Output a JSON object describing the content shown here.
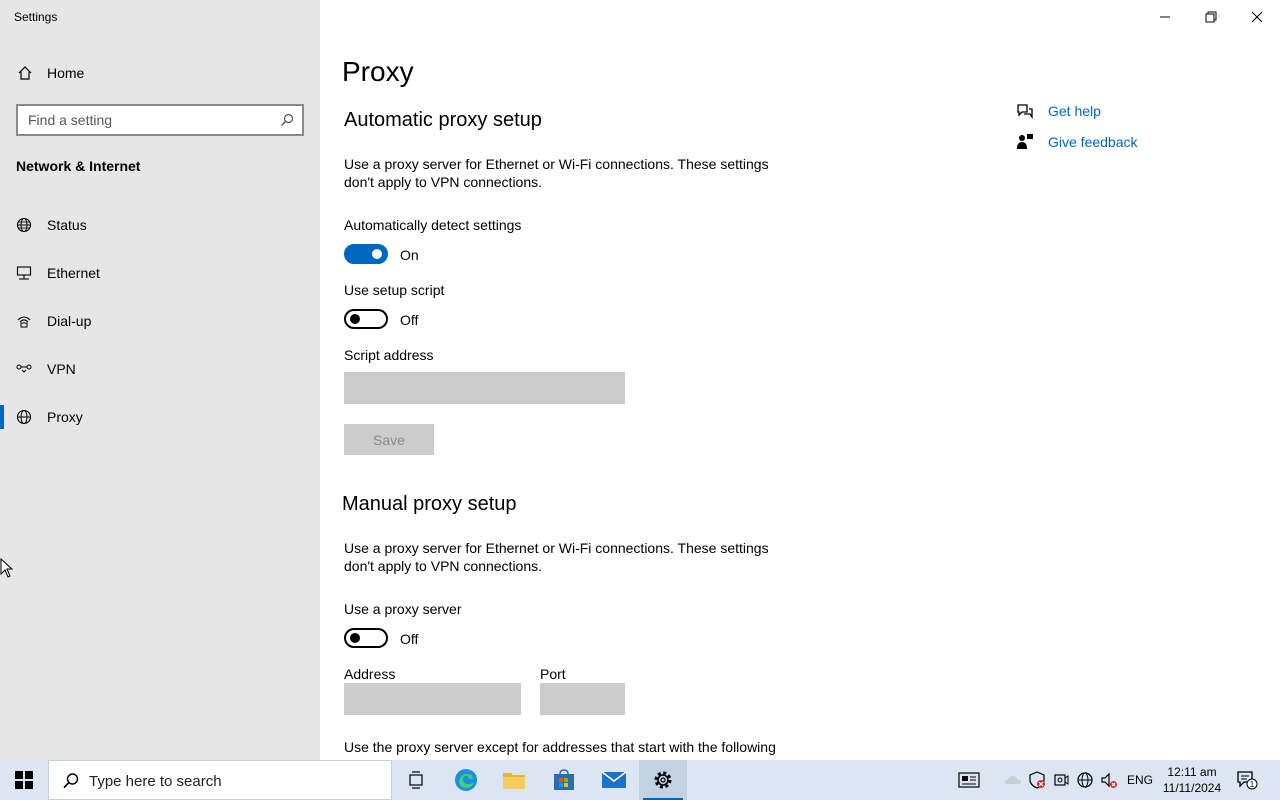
{
  "window": {
    "title": "Settings"
  },
  "sidebar": {
    "home_label": "Home",
    "search_placeholder": "Find a setting",
    "section_label": "Network & Internet",
    "items": [
      {
        "label": "Status",
        "icon": "globe-icon"
      },
      {
        "label": "Ethernet",
        "icon": "ethernet-icon"
      },
      {
        "label": "Dial-up",
        "icon": "dialup-icon"
      },
      {
        "label": "VPN",
        "icon": "vpn-icon"
      },
      {
        "label": "Proxy",
        "icon": "globe-icon",
        "active": true
      }
    ]
  },
  "main": {
    "page_title": "Proxy",
    "automatic": {
      "heading": "Automatic proxy setup",
      "description": "Use a proxy server for Ethernet or Wi-Fi connections. These settings don't apply to VPN connections.",
      "detect_label": "Automatically detect settings",
      "detect_state": "On",
      "script_label": "Use setup script",
      "script_state": "Off",
      "address_label": "Script address",
      "address_value": "",
      "save_label": "Save"
    },
    "manual": {
      "heading": "Manual proxy setup",
      "description": "Use a proxy server for Ethernet or Wi-Fi connections. These settings don't apply to VPN connections.",
      "use_proxy_label": "Use a proxy server",
      "use_proxy_state": "Off",
      "address_label": "Address",
      "port_label": "Port",
      "address_value": "",
      "port_value": "",
      "exceptions_label": "Use the proxy server except for addresses that start with the following"
    },
    "help": {
      "get_help": "Get help",
      "give_feedback": "Give feedback"
    }
  },
  "taskbar": {
    "search_placeholder": "Type here to search",
    "language": "ENG",
    "time": "12:11 am",
    "date": "11/11/2024",
    "notification_count": "1"
  },
  "colors": {
    "accent": "#0067c0",
    "sidebar_bg": "#e6e6e6",
    "disabled_field": "#cccccc",
    "taskbar_bg": "#dbe6f2"
  }
}
